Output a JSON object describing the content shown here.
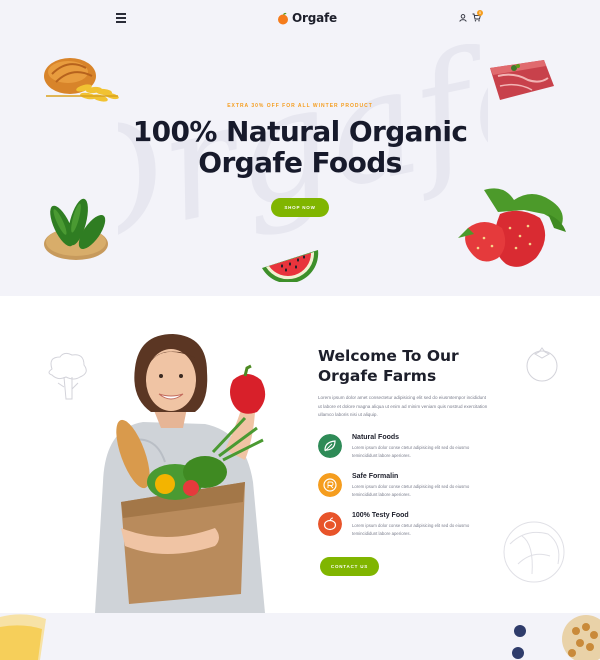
{
  "header": {
    "brand": "Orgafe",
    "cart_count": "0"
  },
  "hero": {
    "eyebrow": "EXTRA 30% OFF FOR ALL WINTER PRODUCT",
    "title_line1": "100% Natural Organic",
    "title_line2": "Orgafe Foods",
    "watermark": "Orgafe",
    "cta_label": "SHOP NOW"
  },
  "welcome": {
    "title_line1": "Welcome To Our",
    "title_line2": "Orgafe Farms",
    "description": "Lorem ipsum dolor amet consectetur adipisicing elit sed do eiusmtempor incididunt ut labore et dolore magna aliqua ut enim ad minim veniam quis nostrud exercitation ullamco laboris nisi ut aliquip.",
    "features": [
      {
        "title": "Natural Foods",
        "text": "Lorem ipsum dolor conse ctetur adipisicing elit sed do eiusmo temincididunt labore aperiores.",
        "icon": "leaf-icon",
        "color": "#2e8b57"
      },
      {
        "title": "Safe Formalin",
        "text": "Lorem ipsum dolor conse ctetur adipisicing elit sed do eiusmo temincididunt labore aperiores.",
        "icon": "safe-icon",
        "color": "#f59d1e"
      },
      {
        "title": "100% Testy Food",
        "text": "Lorem ipsum dolor conse ctetur adipisicing elit sed do eiusmo temincididunt labore aperiores.",
        "icon": "food-icon",
        "color": "#e8542a"
      }
    ],
    "cta_label": "CONTACT US"
  },
  "colors": {
    "accent_green": "#80b500",
    "accent_orange": "#f59d1e",
    "hero_bg": "#f3f3f9"
  }
}
